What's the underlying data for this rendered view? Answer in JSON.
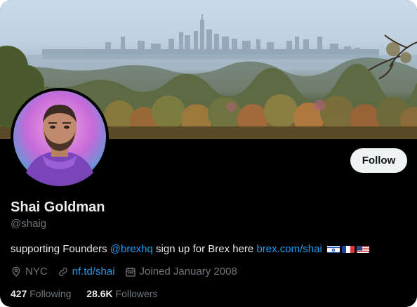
{
  "profile": {
    "name": "Shai Goldman",
    "handle": "@shaig",
    "follow_label": "Follow",
    "bio": {
      "text_before": "supporting Founders ",
      "mention": "@brexhq",
      "text_middle": " sign up for Brex here ",
      "link": "brex.com/shai",
      "flags": [
        "israel-flag-icon",
        "france-flag-icon",
        "usa-flag-icon"
      ]
    },
    "meta": {
      "location": "NYC",
      "website": "nf.td/shai",
      "joined": "Joined January 2008"
    },
    "stats": {
      "following_count": "427",
      "following_label": "Following",
      "followers_count": "28.6K",
      "followers_label": "Followers"
    }
  },
  "colors": {
    "background": "#000000",
    "accent_link": "#1d9bf0",
    "primary_text": "#e7e9ea",
    "secondary_text": "#71767b",
    "follow_button_bg": "#eff3f4"
  }
}
